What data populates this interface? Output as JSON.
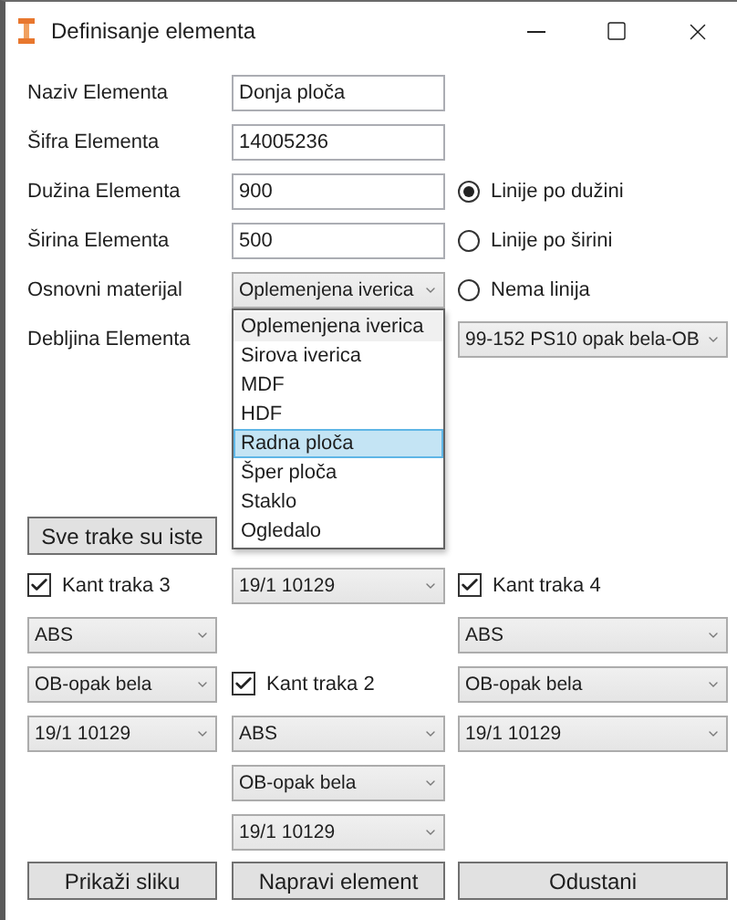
{
  "window": {
    "title": "Definisanje elementa"
  },
  "text_fields": [
    {
      "label": "Naziv Elementa",
      "value": "Donja ploča"
    },
    {
      "label": "Šifra Elementa",
      "value": "14005236"
    },
    {
      "label": "Dužina Elementa",
      "value": "900"
    },
    {
      "label": "Širina Elementa",
      "value": "500"
    }
  ],
  "radios": [
    {
      "label": "Linije po dužini",
      "selected": true
    },
    {
      "label": "Linije po širini",
      "selected": false
    },
    {
      "label": "Nema linija",
      "selected": false
    }
  ],
  "material": {
    "label": "Osnovni materijal",
    "value": "Oplemenjena iverica",
    "options": [
      {
        "label": "Oplemenjena iverica",
        "selected": true,
        "highlighted": false
      },
      {
        "label": "Sirova iverica",
        "selected": false,
        "highlighted": false
      },
      {
        "label": "MDF",
        "selected": false,
        "highlighted": false
      },
      {
        "label": "HDF",
        "selected": false,
        "highlighted": false
      },
      {
        "label": "Radna ploča",
        "selected": false,
        "highlighted": true
      },
      {
        "label": "Šper ploča",
        "selected": false,
        "highlighted": false
      },
      {
        "label": "Staklo",
        "selected": false,
        "highlighted": false
      },
      {
        "label": "Ogledalo",
        "selected": false,
        "highlighted": false
      }
    ]
  },
  "thickness": {
    "label": "Debljina Elementa"
  },
  "column_3_combo": {
    "value": "99-152 PS10 opak bela-OB"
  },
  "same_edges_button": "Sve trake su iste",
  "column_2_combo": {
    "value": "19/1 10129"
  },
  "edge_bands": [
    {
      "label": "Kant traka 3",
      "checked": true,
      "combos": [
        "ABS",
        "OB-opak bela",
        "19/1 10129"
      ]
    },
    {
      "label": "Kant traka 4",
      "checked": true,
      "combos": [
        "ABS",
        "OB-opak bela",
        "19/1 10129"
      ]
    },
    {
      "label": "Kant traka 2",
      "checked": true,
      "combos": [
        "ABS",
        "OB-opak bela",
        "19/1 10129"
      ]
    }
  ],
  "buttons": [
    "Prikaži sliku",
    "Napravi element",
    "Odustani"
  ]
}
